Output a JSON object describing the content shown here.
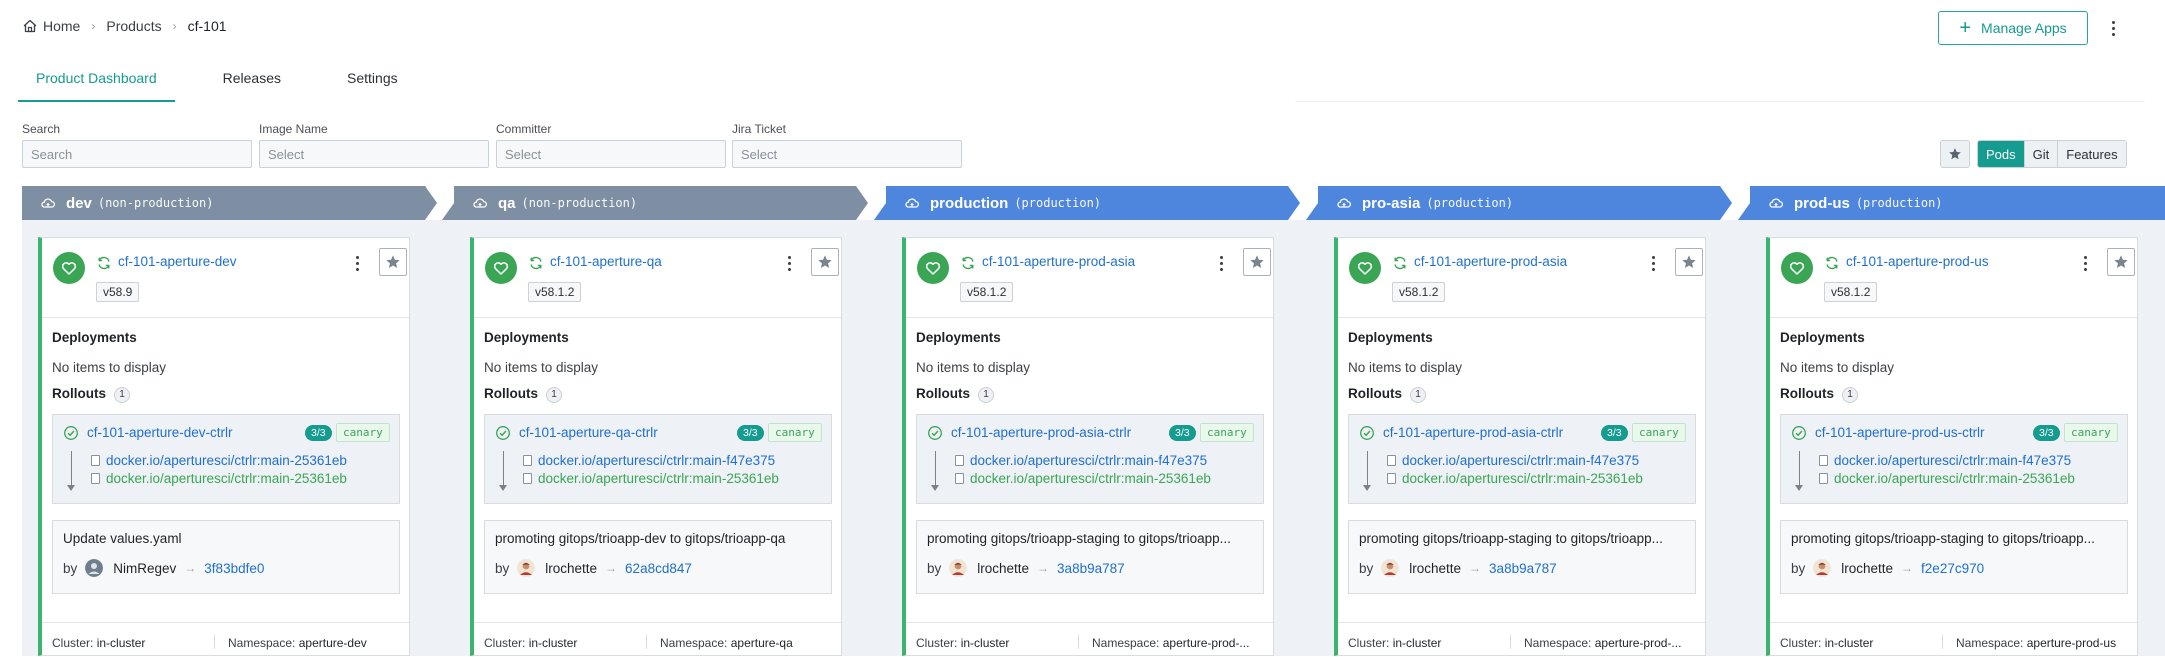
{
  "breadcrumb": {
    "home": "Home",
    "products": "Products",
    "current": "cf-101"
  },
  "header": {
    "manage_apps_label": "Manage Apps"
  },
  "tabs": [
    {
      "label": "Product Dashboard",
      "active": true
    },
    {
      "label": "Releases",
      "active": false
    },
    {
      "label": "Settings",
      "active": false
    }
  ],
  "filters": [
    {
      "label": "Search",
      "placeholder": "Search"
    },
    {
      "label": "Image Name",
      "placeholder": "Select"
    },
    {
      "label": "Committer",
      "placeholder": "Select"
    },
    {
      "label": "Jira Ticket",
      "placeholder": "Select"
    }
  ],
  "view_toggle": {
    "options": [
      "Pods",
      "Git",
      "Features"
    ],
    "selected": "Pods"
  },
  "colors": {
    "accent": "#159b8f",
    "nonprod_header": "#7f8fa3",
    "prod_header": "#4f86dd",
    "healthy": "#3aa655",
    "link": "#1f6fd1"
  },
  "labels": {
    "deployments": "Deployments",
    "no_items": "No items to display",
    "rollouts": "Rollouts",
    "by": "by",
    "cluster": "Cluster:",
    "namespace": "Namespace:"
  },
  "environments": [
    {
      "name": "dev",
      "kind": "(non-production)",
      "production": false,
      "app": "cf-101-aperture-dev",
      "version": "v58.9",
      "rollouts_count": "1",
      "rollout": {
        "name": "cf-101-aperture-dev-ctrlr",
        "pods": "3/3",
        "strategy": "canary",
        "image_new": "docker.io/aperturesci/ctrlr:main-25361eb",
        "image_old": "docker.io/aperturesci/ctrlr:main-25361eb"
      },
      "commit": {
        "message": "Update values.yaml",
        "author": "NimRegev",
        "sha": "3f83bdfe0",
        "avatar": "default"
      },
      "cluster": "in-cluster",
      "namespace": "aperture-dev"
    },
    {
      "name": "qa",
      "kind": "(non-production)",
      "production": false,
      "app": "cf-101-aperture-qa",
      "version": "v58.1.2",
      "rollouts_count": "1",
      "rollout": {
        "name": "cf-101-aperture-qa-ctrlr",
        "pods": "3/3",
        "strategy": "canary",
        "image_new": "docker.io/aperturesci/ctrlr:main-f47e375",
        "image_old": "docker.io/aperturesci/ctrlr:main-25361eb"
      },
      "commit": {
        "message": "promoting gitops/trioapp-dev to gitops/trioapp-qa",
        "author": "lrochette",
        "sha": "62a8cd847",
        "avatar": "photo"
      },
      "cluster": "in-cluster",
      "namespace": "aperture-qa"
    },
    {
      "name": "production",
      "kind": "(production)",
      "production": true,
      "app": "cf-101-aperture-prod-asia",
      "version": "v58.1.2",
      "rollouts_count": "1",
      "rollout": {
        "name": "cf-101-aperture-prod-asia-ctrlr",
        "pods": "3/3",
        "strategy": "canary",
        "image_new": "docker.io/aperturesci/ctrlr:main-f47e375",
        "image_old": "docker.io/aperturesci/ctrlr:main-25361eb"
      },
      "commit": {
        "message": "promoting gitops/trioapp-staging to gitops/trioapp...",
        "author": "lrochette",
        "sha": "3a8b9a787",
        "avatar": "photo"
      },
      "cluster": "in-cluster",
      "namespace": "aperture-prod-..."
    },
    {
      "name": "pro-asia",
      "kind": "(production)",
      "production": true,
      "app": "cf-101-aperture-prod-asia",
      "version": "v58.1.2",
      "rollouts_count": "1",
      "rollout": {
        "name": "cf-101-aperture-prod-asia-ctrlr",
        "pods": "3/3",
        "strategy": "canary",
        "image_new": "docker.io/aperturesci/ctrlr:main-f47e375",
        "image_old": "docker.io/aperturesci/ctrlr:main-25361eb"
      },
      "commit": {
        "message": "promoting gitops/trioapp-staging to gitops/trioapp...",
        "author": "lrochette",
        "sha": "3a8b9a787",
        "avatar": "photo"
      },
      "cluster": "in-cluster",
      "namespace": "aperture-prod-..."
    },
    {
      "name": "prod-us",
      "kind": "(production)",
      "production": true,
      "app": "cf-101-aperture-prod-us",
      "version": "v58.1.2",
      "rollouts_count": "1",
      "rollout": {
        "name": "cf-101-aperture-prod-us-ctrlr",
        "pods": "3/3",
        "strategy": "canary",
        "image_new": "docker.io/aperturesci/ctrlr:main-f47e375",
        "image_old": "docker.io/aperturesci/ctrlr:main-25361eb"
      },
      "commit": {
        "message": "promoting gitops/trioapp-staging to gitops/trioapp...",
        "author": "lrochette",
        "sha": "f2e27c970",
        "avatar": "photo"
      },
      "cluster": "in-cluster",
      "namespace": "aperture-prod-us"
    }
  ]
}
